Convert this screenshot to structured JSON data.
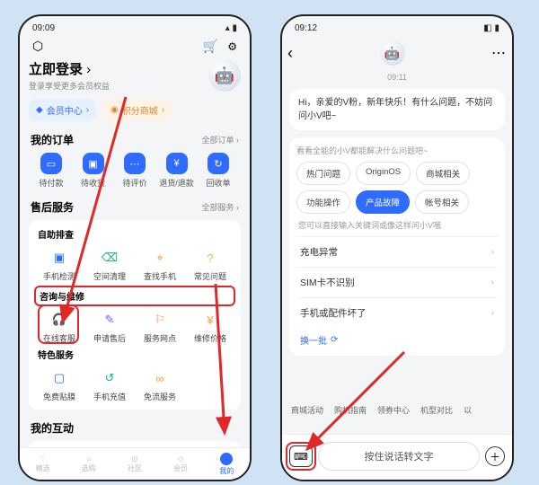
{
  "left": {
    "status_time": "09:09",
    "login_title": "立即登录",
    "login_subtitle": "登录享受更多会员权益",
    "cta_blue": "会员中心",
    "cta_gold": "积分商城",
    "orders_title": "我的订单",
    "orders_link": "全部订单 ›",
    "orders": [
      {
        "label": "待付款"
      },
      {
        "label": "待收货"
      },
      {
        "label": "待评价"
      },
      {
        "label": "退货/退款"
      },
      {
        "label": "回收单"
      }
    ],
    "after_title": "售后服务",
    "after_link": "全部服务 ›",
    "self_check": "自助排查",
    "self_items": [
      {
        "label": "手机检测",
        "color": "#2f6bff",
        "glyph": "☑"
      },
      {
        "label": "空间清理",
        "color": "#19b37a",
        "glyph": "⌫"
      },
      {
        "label": "查找手机",
        "color": "#ff9a3c",
        "glyph": "⌖"
      },
      {
        "label": "常见问题",
        "color": "#ffb13c",
        "glyph": "?"
      }
    ],
    "consult": "咨询与维修",
    "consult_items": [
      {
        "label": "在线客服",
        "color": "#19b37a",
        "glyph": "🎧"
      },
      {
        "label": "申请售后",
        "color": "#7a5bff",
        "glyph": "✎"
      },
      {
        "label": "服务网点",
        "color": "#ff8a3c",
        "glyph": "⚐"
      },
      {
        "label": "维修价格",
        "color": "#ff9a3c",
        "glyph": "¥"
      }
    ],
    "special": "特色服务",
    "special_items": [
      {
        "label": "免费贴膜",
        "color": "#2f6bff",
        "glyph": "▢"
      },
      {
        "label": "手机充值",
        "color": "#19b37a",
        "glyph": "↺"
      },
      {
        "label": "免流服务",
        "color": "#ff9a3c",
        "glyph": "∞"
      }
    ],
    "interact_title": "我的互动",
    "circle_colors": [
      "#ff8a4a",
      "#ffc24a",
      "#29cfa9",
      "#2f6bff",
      "#e02828"
    ],
    "tabs": [
      "精选",
      "选购",
      "社区",
      "会员",
      "我的"
    ]
  },
  "right": {
    "status_time": "09:12",
    "time_stamp": "09:11",
    "greeting": "Hi，亲爱的V粉，新年快乐！有什么问题，不妨问问小V吧~",
    "chip_title": "看看全能的小V都能解决什么问题吧~",
    "chips": [
      "热门问题",
      "OriginOS",
      "商城相关",
      "功能操作",
      "产品故障",
      "帐号相关"
    ],
    "active_chip_index": 4,
    "sub_hint": "您可以直接输入关键词或像这样问小V哦",
    "list": [
      "充电异常",
      "SIM卡不识别",
      "手机或配件坏了"
    ],
    "refresh": "换一批",
    "suggestions": [
      "商城活动",
      "购机指南",
      "领券中心",
      "机型对比",
      "以"
    ],
    "voice_text": "按住说话转文字"
  }
}
